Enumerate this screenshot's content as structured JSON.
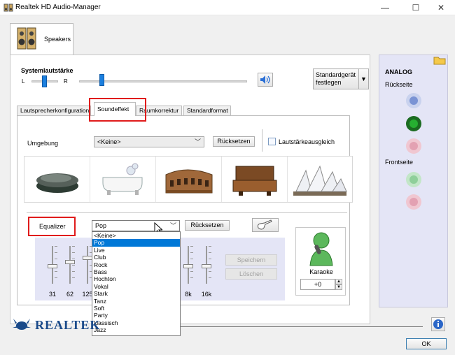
{
  "window": {
    "title": "Realtek HD Audio-Manager",
    "minimize": "—",
    "maximize": "☐",
    "close": "✕"
  },
  "device_tab": {
    "label": "Speakers"
  },
  "volume": {
    "title": "Systemlautstärke",
    "left": "L",
    "right": "R",
    "default_device_button": [
      "Standardgerät",
      "festlegen"
    ]
  },
  "tabs": [
    "Lautsprecherkonfiguration",
    "Soundeffekt",
    "Raumkorrektur",
    "Standardformat"
  ],
  "environment": {
    "label": "Umgebung",
    "select_value": "<Keine>",
    "reset_label": "Rücksetzen",
    "loudness_label": "Lautstärkeausgleich",
    "presets": [
      "stone-icon",
      "bathtub-icon",
      "colosseum-icon",
      "sofa-icon",
      "opera-house-icon"
    ]
  },
  "equalizer": {
    "label": "Equalizer",
    "select_value": "Pop",
    "reset_label": "Rücksetzen",
    "options": [
      "<Keine>",
      "Pop",
      "Live",
      "Club",
      "Rock",
      "Bass",
      "Hochton",
      "Vokal",
      "Stark",
      "Tanz",
      "Soft",
      "Party",
      "klassisch",
      "Jazz"
    ],
    "selected_index": 1,
    "freq_labels_left": [
      "31",
      "62",
      "125"
    ],
    "freq_labels_right": [
      "8k",
      "16k"
    ],
    "save_label": "Speichern",
    "delete_label": "Löschen"
  },
  "karaoke": {
    "label": "Karaoke",
    "value": "+0"
  },
  "right_panel": {
    "title": "ANALOG",
    "rear_label": "Rückseite",
    "front_label": "Frontseite",
    "colors": {
      "blue": "#7a93d4",
      "green": "#1f9a2a",
      "pink": "#e3a1b2",
      "front_green": "#8fcf9a",
      "front_pink": "#e3a1b2"
    }
  },
  "footer": {
    "brand": "REALTEK",
    "ok_label": "OK",
    "info_icon": "info-icon"
  }
}
